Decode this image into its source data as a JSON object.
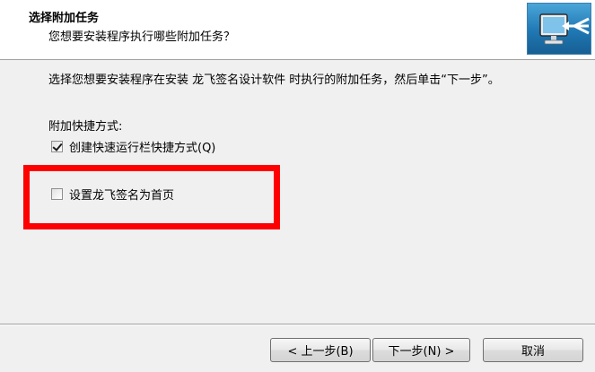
{
  "header": {
    "title": "选择附加任务",
    "subtitle": "您想要安装程序执行哪些附加任务？",
    "logo_icon": "computer-install-icon"
  },
  "main": {
    "instruction": "选择您想要安装程序在安装 龙飞签名设计软件 时执行的附加任务，然后单击“下一步”。",
    "group_label": "附加快捷方式:",
    "options": [
      {
        "label": "创建快速运行栏快捷方式(Q)",
        "checked": true
      },
      {
        "label": "设置龙飞签名为首页",
        "checked": false
      }
    ]
  },
  "buttons": {
    "back": "< 上一步(B)",
    "next": "下一步(N) >",
    "cancel": "取消"
  },
  "colors": {
    "highlight_border": "#ff0000",
    "background": "#f0f0f0"
  }
}
